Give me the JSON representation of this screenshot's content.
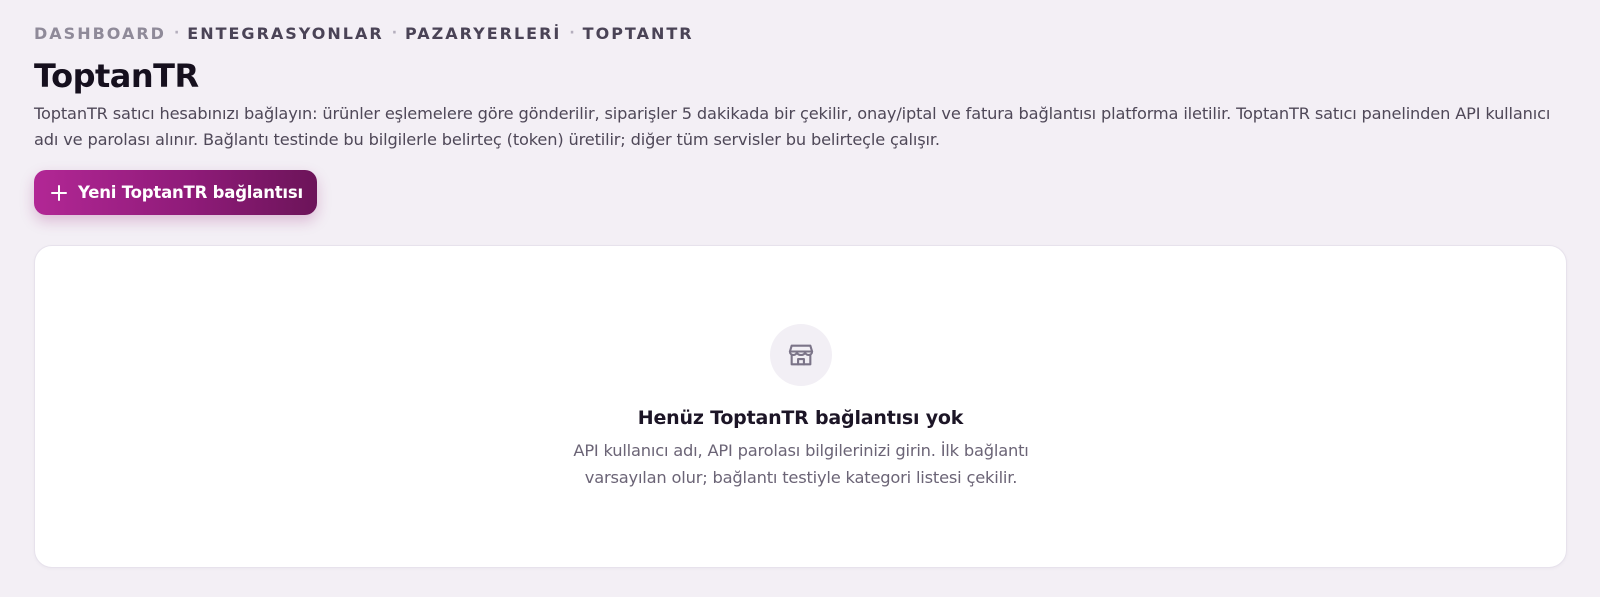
{
  "breadcrumb": {
    "items": [
      "DASHBOARD",
      "ENTEGRASYONLAR",
      "PAZARYERLERİ",
      "TOPTANTR"
    ],
    "separator": "·"
  },
  "page": {
    "title": "ToptanTR",
    "description": "ToptanTR satıcı hesabınızı bağlayın: ürünler eşlemelere göre gönderilir, siparişler 5 dakikada bir çekilir, onay/iptal ve fatura bağlantısı platforma iletilir. ToptanTR satıcı panelinden API kullanıcı adı ve parolası alınır. Bağlantı testinde bu bilgilerle belirteç (token) üretilir; diğer tüm servisler bu belirteçle çalışır."
  },
  "actions": {
    "new_connection_label": "Yeni ToptanTR bağlantısı",
    "new_connection_icon": "plus-icon"
  },
  "empty_state": {
    "icon": "store-icon",
    "title": "Henüz ToptanTR bağlantısı yok",
    "line1": "API kullanıcı adı, API parolası bilgilerinizi girin. İlk bağlantı",
    "line2": "varsayılan olur; bağlantı testiyle kategori listesi çekilir."
  },
  "colors": {
    "background": "#f3eff5",
    "accent_start": "#b22795",
    "accent_end": "#6c1459",
    "card": "#ffffff",
    "muted_text": "#6b6476"
  }
}
